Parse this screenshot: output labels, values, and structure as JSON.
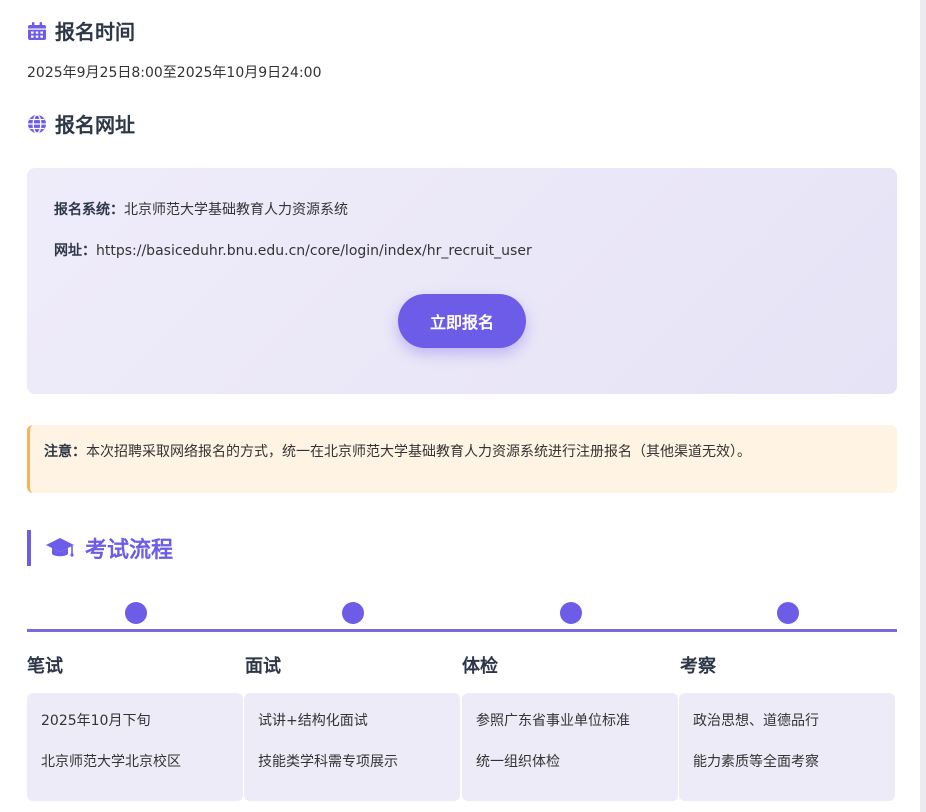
{
  "registration_time": {
    "heading": "报名时间",
    "value": "2025年9月25日8:00至2025年10月9日24:00"
  },
  "registration_site": {
    "heading": "报名网址",
    "system_label": "报名系统：",
    "system_value": "北京师范大学基础教育人力资源系统",
    "url_label": "网址：",
    "url_value": "https://basiceduhr.bnu.edu.cn/core/login/index/hr_recruit_user",
    "apply_button": "立即报名"
  },
  "notice": {
    "label": "注意：",
    "text": "本次招聘采取网络报名的方式，统一在北京师范大学基础教育人力资源系统进行注册报名（其他渠道无效）。"
  },
  "exam_flow": {
    "heading": "考试流程",
    "steps": [
      {
        "name": "笔试",
        "lines": [
          "2025年10月下旬",
          "北京师范大学北京校区"
        ]
      },
      {
        "name": "面试",
        "lines": [
          "试讲+结构化面试",
          "技能类学科需专项展示"
        ]
      },
      {
        "name": "体检",
        "lines": [
          "参照广东省事业单位标准",
          "统一组织体检"
        ]
      },
      {
        "name": "考察",
        "lines": [
          "政治思想、道德品行",
          "能力素质等全面考察"
        ]
      }
    ]
  },
  "icons": {
    "calendar": "calendar-icon",
    "globe": "globe-icon",
    "graduation": "graduation-cap-icon"
  },
  "colors": {
    "accent": "#6c5ce7",
    "notice_border": "#f6b25c",
    "notice_bg": "#fff3e3",
    "box_bg": "#ebe8f7"
  }
}
